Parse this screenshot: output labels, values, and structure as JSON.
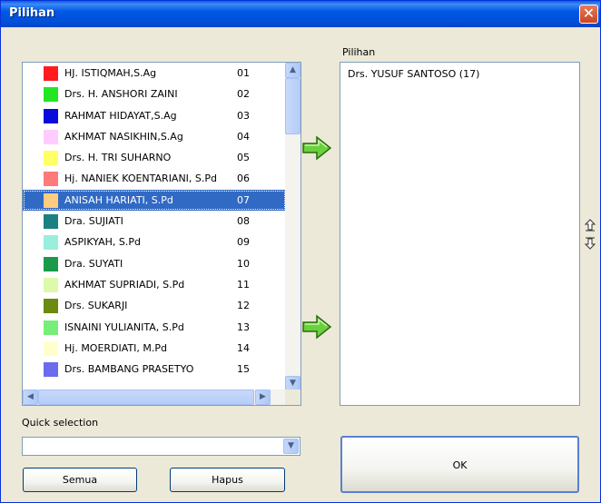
{
  "window": {
    "title": "Pilihan",
    "close_label": "✕"
  },
  "list": {
    "rows": [
      {
        "name": "HJ. ISTIQMAH,S.Ag",
        "num": "01",
        "color": "#ff1c1c"
      },
      {
        "name": "Drs. H.  ANSHORI ZAINI",
        "num": "02",
        "color": "#22e622"
      },
      {
        "name": "RAHMAT HIDAYAT,S.Ag",
        "num": "03",
        "color": "#0a0adc"
      },
      {
        "name": "AKHMAT NASIKHIN,S.Ag",
        "num": "04",
        "color": "#ffccff"
      },
      {
        "name": "Drs. H. TRI SUHARNO",
        "num": "05",
        "color": "#ffff66"
      },
      {
        "name": "Hj. NANIEK KOENTARIANI, S.Pd",
        "num": "06",
        "color": "#ff7a7a"
      },
      {
        "name": "ANISAH HARIATI, S.Pd",
        "num": "07",
        "color": "#ffcc80",
        "selected": true
      },
      {
        "name": "Dra. SUJIATI",
        "num": "08",
        "color": "#1a8080"
      },
      {
        "name": "ASPIKYAH, S.Pd",
        "num": "09",
        "color": "#99eedd"
      },
      {
        "name": "Dra. SUYATI",
        "num": "10",
        "color": "#1a9a4a"
      },
      {
        "name": "AKHMAT SUPRIADI, S.Pd",
        "num": "11",
        "color": "#ddfaaa"
      },
      {
        "name": "Drs. SUKARJI",
        "num": "12",
        "color": "#6b8a10"
      },
      {
        "name": "ISNAINI YULIANITA, S.Pd",
        "num": "13",
        "color": "#77ee77"
      },
      {
        "name": "Hj. MOERDIATI, M.Pd",
        "num": "14",
        "color": "#ffffcc"
      },
      {
        "name": "Drs. BAMBANG PRASETYO",
        "num": "15",
        "color": "#6b6bee"
      }
    ]
  },
  "selected_panel": {
    "label": "Pilihan",
    "items": [
      "Drs. YUSUF SANTOSO (17)"
    ]
  },
  "quick_selection": {
    "label": "Quick selection",
    "value": ""
  },
  "buttons": {
    "all": "Semua",
    "delete": "Hapus",
    "ok": "OK"
  }
}
